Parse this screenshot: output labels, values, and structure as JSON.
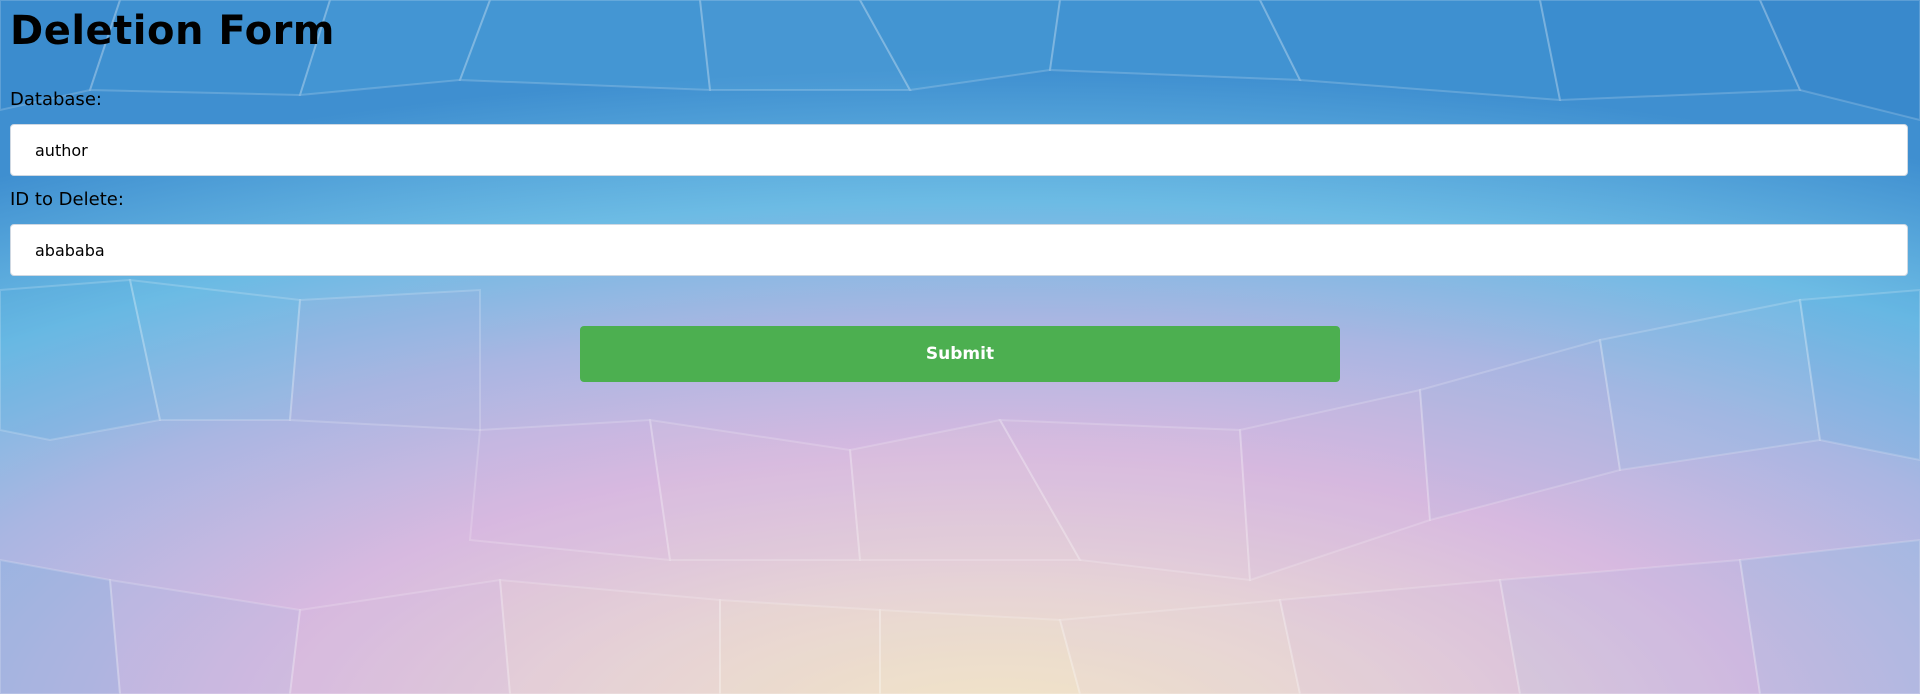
{
  "form": {
    "title": "Deletion Form",
    "database_label": "Database:",
    "database_value": "author",
    "id_label": "ID to Delete:",
    "id_value": "abababa",
    "submit_label": "Submit"
  },
  "colors": {
    "submit_bg": "#4caf50",
    "background_blue": "#4aa3dc",
    "background_pink": "#d6b8e0",
    "background_cream": "#f0e4c8"
  }
}
